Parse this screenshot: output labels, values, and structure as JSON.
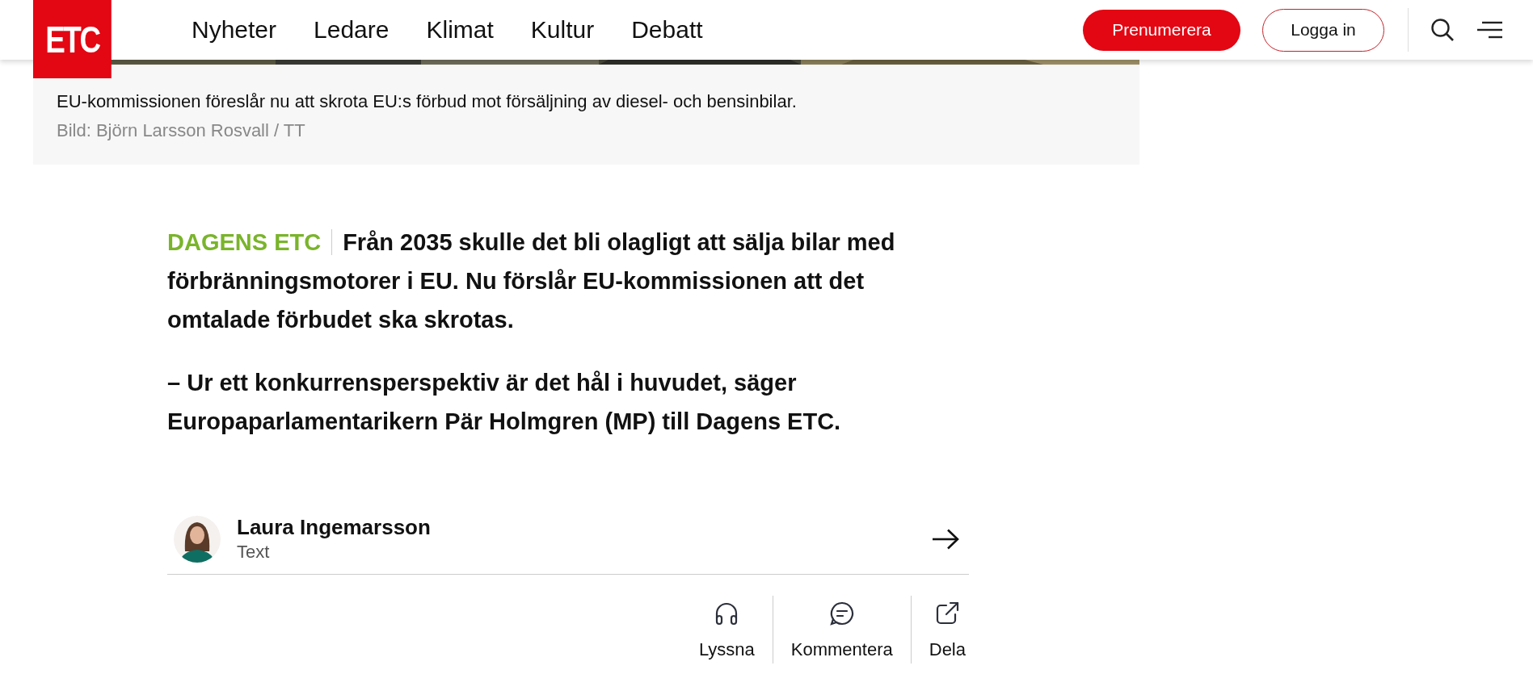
{
  "header": {
    "logo": "ETC",
    "nav": [
      "Nyheter",
      "Ledare",
      "Klimat",
      "Kultur",
      "Debatt"
    ],
    "subscribe_button": "Prenumerera",
    "login_button": "Logga in"
  },
  "hero": {
    "caption": "EU-kommissionen föreslår nu att skrota EU:s förbud mot försäljning av diesel- och bensinbilar.",
    "credit": "Bild: Björn Larsson Rosvall / TT"
  },
  "article": {
    "section_label": "DAGENS ETC",
    "lead": "Från 2035 skulle det bli olagligt att sälja bilar med förbränningsmotorer i EU. Nu förslår EU-kommissionen att det omtalade förbudet ska skrotas.",
    "paragraphs": [
      "– Ur ett konkurrensperspektiv är det hål i huvudet, säger Europaparlamentarikern Pär Holmgren (MP) till Dagens ETC."
    ]
  },
  "byline": {
    "author": "Laura Ingemarsson",
    "role": "Text"
  },
  "actions": [
    {
      "kind": "listen",
      "label": "Lyssna"
    },
    {
      "kind": "comment",
      "label": "Kommentera"
    },
    {
      "kind": "share",
      "label": "Dela"
    }
  ]
}
